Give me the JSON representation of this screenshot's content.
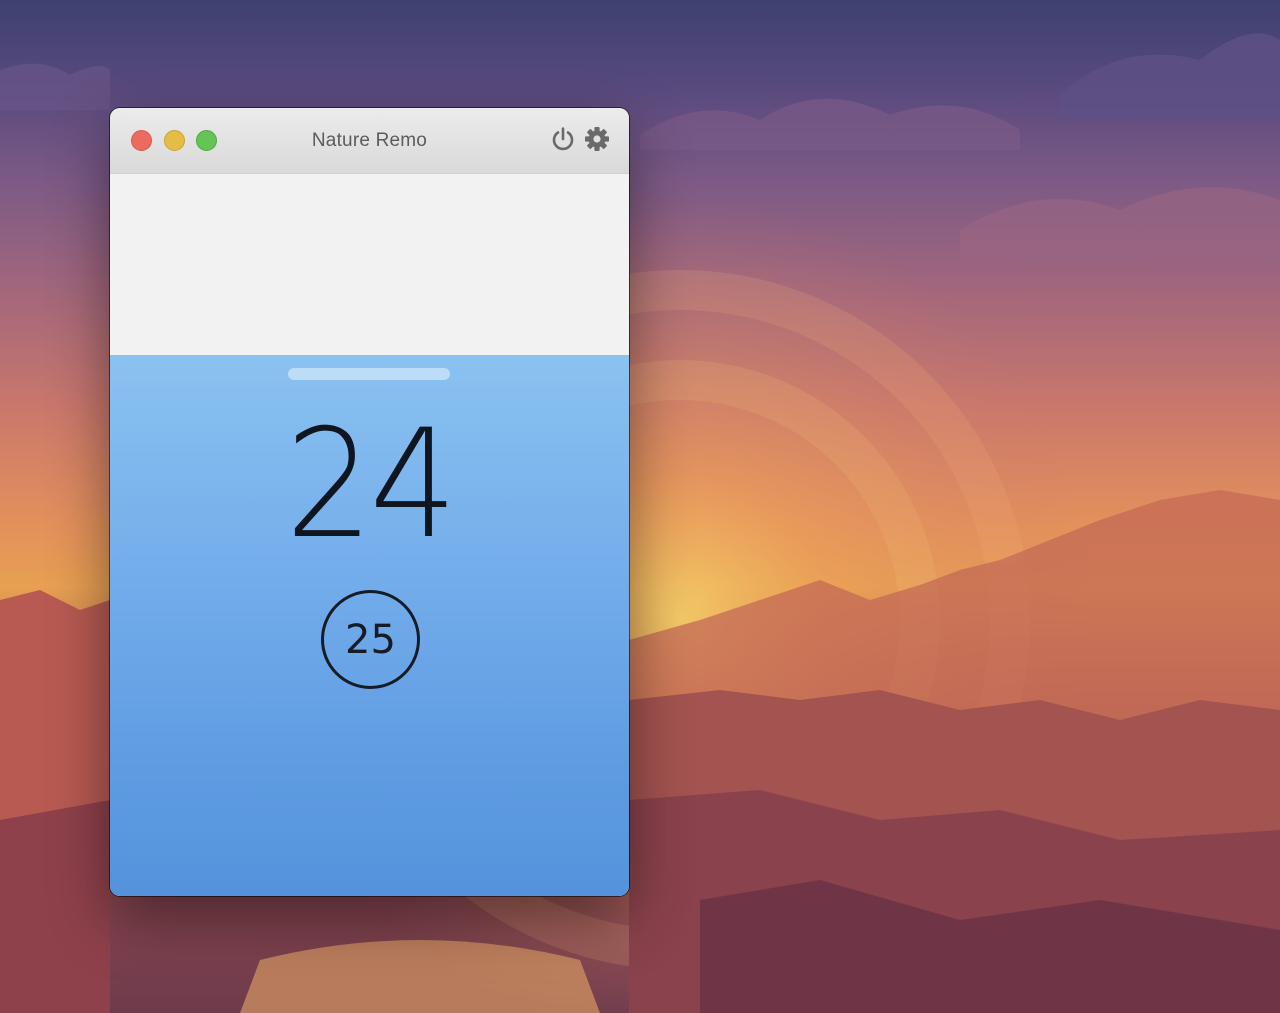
{
  "window": {
    "title": "Nature Remo"
  },
  "titlebar": {
    "buttons": [
      {
        "name": "close",
        "color": "#ed6a5e"
      },
      {
        "name": "minimize",
        "color": "#e4bd47"
      },
      {
        "name": "zoom",
        "color": "#62c554"
      }
    ],
    "icons": [
      "power-icon",
      "gear-icon"
    ]
  },
  "thermostat": {
    "current_temperature": "24",
    "target_temperature": "25",
    "panel_color_top": "#8ac2f0",
    "panel_color_bottom": "#5493dc"
  }
}
